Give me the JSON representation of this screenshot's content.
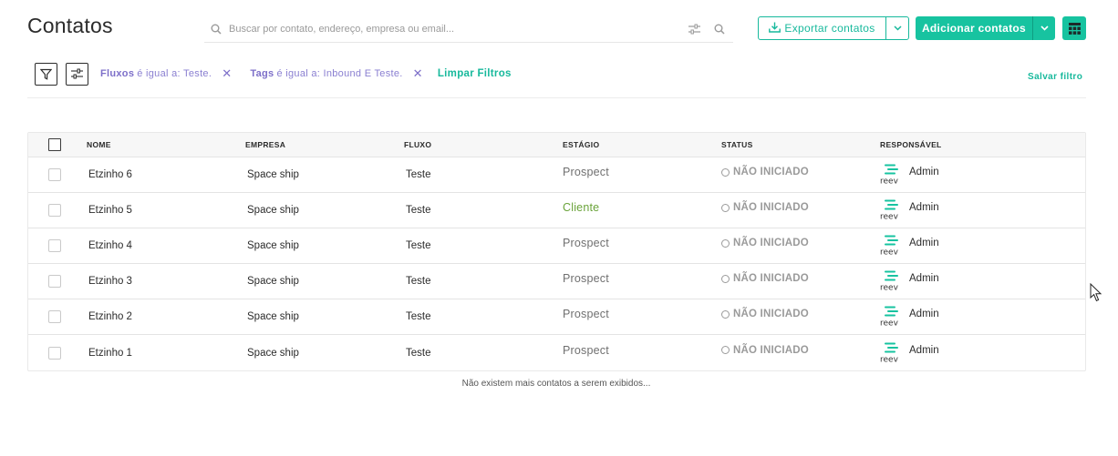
{
  "header": {
    "title": "Contatos",
    "search_placeholder": "Buscar por contato, endereço, empresa ou email...",
    "export_label": "Exportar contatos",
    "add_label": "Adicionar contatos"
  },
  "filters": {
    "chips": [
      {
        "field": "Fluxos",
        "text": "é igual a: Teste."
      },
      {
        "field": "Tags",
        "text": "é igual a: Inbound E Teste."
      }
    ],
    "clear_label": "Limpar Filtros",
    "save_label": "Salvar filtro"
  },
  "table": {
    "columns": [
      "NOME",
      "EMPRESA",
      "FLUXO",
      "ESTÁGIO",
      "STATUS",
      "RESPONSÁVEL"
    ],
    "rows": [
      {
        "nome": "Etzinho 6",
        "empresa": "Space ship",
        "fluxo": "Teste",
        "estagio": "Prospect",
        "status": "NÃO INICIADO",
        "responsavel": "Admin"
      },
      {
        "nome": "Etzinho 5",
        "empresa": "Space ship",
        "fluxo": "Teste",
        "estagio": "Cliente",
        "status": "NÃO INICIADO",
        "responsavel": "Admin"
      },
      {
        "nome": "Etzinho 4",
        "empresa": "Space ship",
        "fluxo": "Teste",
        "estagio": "Prospect",
        "status": "NÃO INICIADO",
        "responsavel": "Admin"
      },
      {
        "nome": "Etzinho 3",
        "empresa": "Space ship",
        "fluxo": "Teste",
        "estagio": "Prospect",
        "status": "NÃO INICIADO",
        "responsavel": "Admin"
      },
      {
        "nome": "Etzinho 2",
        "empresa": "Space ship",
        "fluxo": "Teste",
        "estagio": "Prospect",
        "status": "NÃO INICIADO",
        "responsavel": "Admin"
      },
      {
        "nome": "Etzinho 1",
        "empresa": "Space ship",
        "fluxo": "Teste",
        "estagio": "Prospect",
        "status": "NÃO INICIADO",
        "responsavel": "Admin"
      }
    ],
    "stage_colors": {
      "Prospect": "#707070",
      "Cliente": "#6aa33a"
    },
    "logo_text": "reev"
  },
  "footer": {
    "message": "Não existem mais contatos a serem exibidos..."
  },
  "colors": {
    "accent": "#17c3a0",
    "filter_chip": "#7d6fc9"
  }
}
